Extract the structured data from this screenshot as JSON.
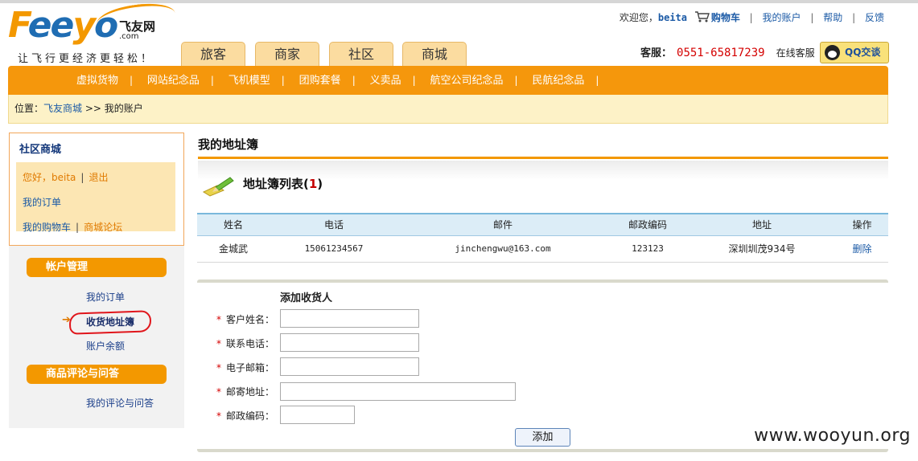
{
  "header": {
    "logo_main": "Feeyo",
    "logo_cn": "飞友网",
    "logo_com": ".com",
    "slogan": "让飞行更经济更轻松！",
    "tabs": [
      "旅客",
      "商家",
      "社区",
      "商城"
    ],
    "welcome_prefix": "欢迎您，",
    "username": "beita",
    "cart_label": "购物车",
    "links": [
      "我的账户",
      "帮助",
      "反馈"
    ],
    "service_label": "客服：",
    "service_phone": "0551-65817239",
    "online_service": "在线客服",
    "qq_label": "QQ交谈"
  },
  "menu": {
    "items": [
      "虚拟货物",
      "网站纪念品",
      "飞机模型",
      "团购套餐",
      "义卖品",
      "航空公司纪念品",
      "民航纪念品"
    ]
  },
  "breadcrumb": {
    "prefix": "位置：",
    "home": "飞友商城",
    "separator": ">>",
    "current": "我的账户"
  },
  "sidebar": {
    "box_title": "社区商城",
    "greeting": "您好，beita",
    "logout": "退出",
    "my_orders": "我的订单",
    "my_cart": "我的购物车",
    "forum": "商城论坛",
    "account_section": "帐户管理",
    "account_links": [
      "我的订单",
      "收货地址簿",
      "账户余额"
    ],
    "review_section": "商品评论与问答",
    "review_links": [
      "我的评论与问答"
    ]
  },
  "main": {
    "title": "我的地址簿",
    "list_title": "地址簿列表(",
    "list_count": "1",
    "list_title_end": ")",
    "columns": [
      "姓名",
      "电话",
      "邮件",
      "邮政编码",
      "地址",
      "操作"
    ],
    "rows": [
      {
        "name": "金城武",
        "phone": "15061234567",
        "email": "jinchengwu@163.com",
        "zip": "123123",
        "address": "深圳圳茂934号",
        "action": "删除"
      }
    ]
  },
  "form": {
    "title": "添加收货人",
    "fields": [
      "客户姓名：",
      "联系电话：",
      "电子邮箱：",
      "邮寄地址：",
      "邮政编码："
    ],
    "submit": "添加"
  },
  "watermark": "www.wooyun.org",
  "colors": {
    "brand_orange": "#f5970c",
    "link_blue": "#1b5aa6",
    "required_red": "#d40000"
  }
}
